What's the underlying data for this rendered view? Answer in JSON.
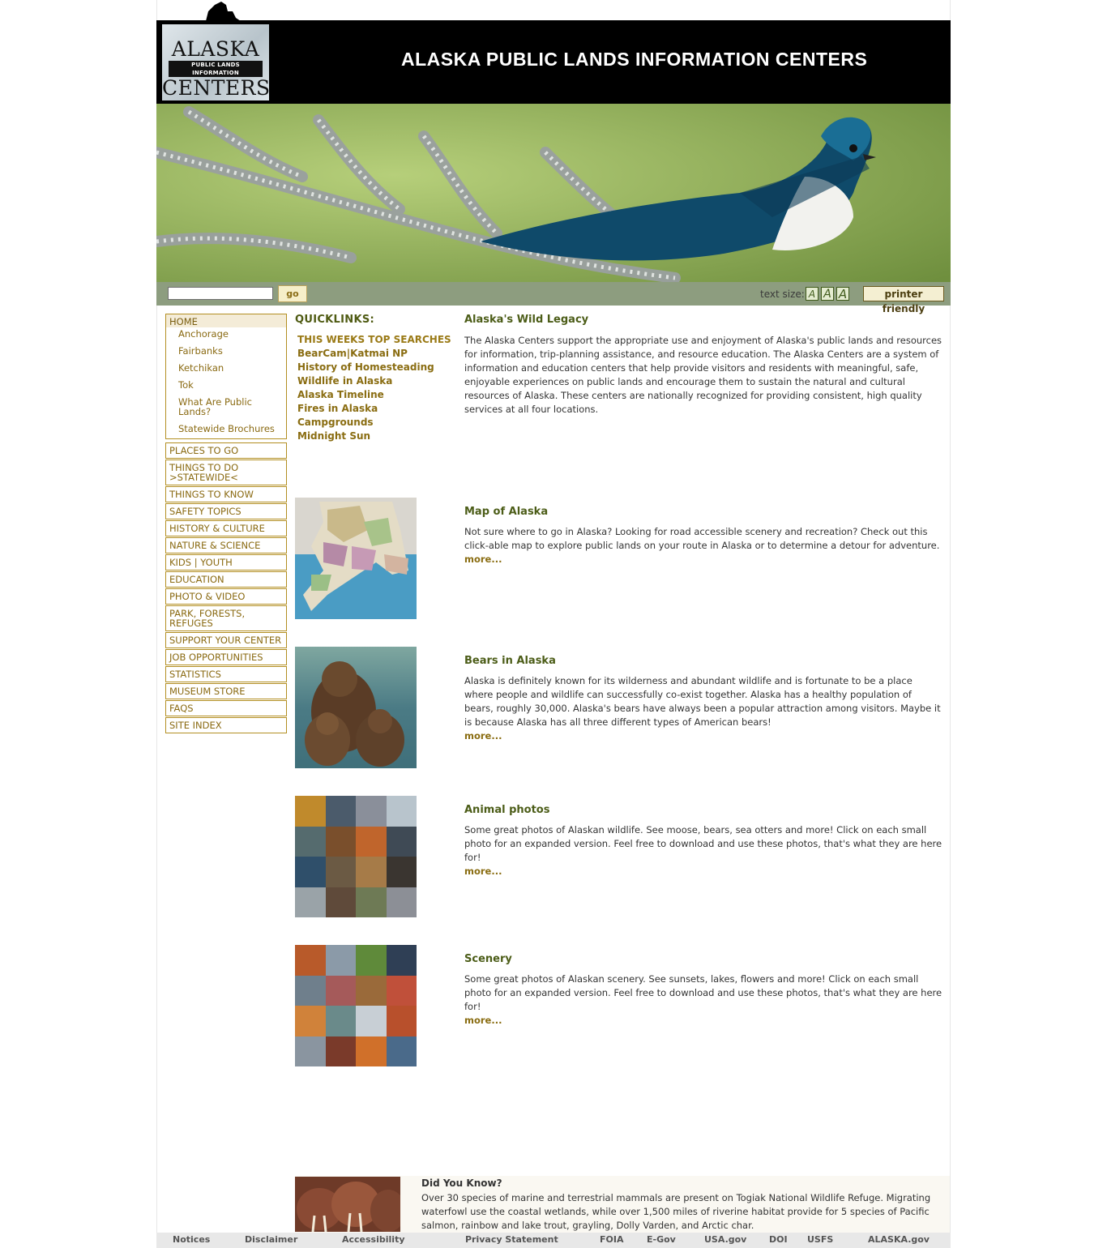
{
  "header": {
    "logo_alaska": "ALASKA",
    "logo_strip": "PUBLIC LANDS INFORMATION",
    "logo_centers": "CENTERS",
    "title": "ALASKA PUBLIC LANDS INFORMATION CENTERS"
  },
  "toolbar": {
    "search_value": "",
    "go_label": "go",
    "text_size_label": "text size:",
    "size_small": "A",
    "size_medium": "A",
    "size_large": "A",
    "printer_label": "printer friendly"
  },
  "sidebar": {
    "home": "HOME",
    "sub_items": [
      "Anchorage",
      "Fairbanks",
      "Ketchikan",
      "Tok",
      "What Are Public Lands?",
      "Statewide Brochures"
    ],
    "items": [
      "PLACES TO GO",
      "THINGS TO DO >STATEWIDE<",
      "THINGS TO KNOW",
      "SAFETY TOPICS",
      "HISTORY & CULTURE",
      "NATURE & SCIENCE",
      "KIDS | YOUTH",
      "EDUCATION",
      "PHOTO & VIDEO",
      "PARK, FORESTS, REFUGES",
      "SUPPORT YOUR CENTER",
      "JOB OPPORTUNITIES",
      "STATISTICS",
      "MUSEUM STORE",
      "FAQS",
      "SITE INDEX"
    ]
  },
  "quicklinks": {
    "title": "QUICKLINKS:",
    "heading": "THIS WEEKS TOP SEARCHES",
    "links": [
      "BearCam|Katmai NP",
      "History of Homesteading",
      "Wildlife in Alaska",
      "Alaska Timeline",
      "Fires in Alaska",
      "Campgrounds",
      "Midnight Sun"
    ]
  },
  "intro": {
    "title": "Alaska's Wild Legacy",
    "text": "The Alaska Centers support the appropriate use and enjoyment of Alaska's public lands and resources for information, trip-planning assistance, and resource education. The Alaska Centers are a system of information and education centers that help provide visitors and residents with meaningful, safe, enjoyable experiences on public lands and encourage them to sustain the natural and cultural resources of Alaska. These centers are nationally recognized for providing consistent, high quality services at all four locations."
  },
  "sections": [
    {
      "title": "Map of Alaska",
      "text": "Not sure where to go in Alaska? Looking for road accessible scenery and recreation? Check out this click-able map to explore public lands on your route in Alaska or to determine a detour for adventure.",
      "more": "more..."
    },
    {
      "title": "Bears in Alaska",
      "text": "Alaska is definitely known for its wilderness and abundant wildlife and is fortunate to be a place where people and wildlife can successfully co-exist together. Alaska has a healthy population of bears, roughly 30,000. Alaska's bears have always been a popular attraction among visitors. Maybe it is because Alaska has all three different types of American bears!",
      "more": "more..."
    },
    {
      "title": "Animal photos",
      "text": "Some great photos of Alaskan wildlife. See moose, bears, sea otters and more! Click on each small photo for an expanded version. Feel free to download and use these photos, that's what they are here for!",
      "more": "more..."
    },
    {
      "title": "Scenery",
      "text": "Some great photos of Alaskan scenery. See sunsets, lakes, flowers and more! Click on each small photo for an expanded version. Feel free to download and use these photos, that's what they are here for!",
      "more": "more..."
    }
  ],
  "did_you_know": {
    "title": "Did You Know?",
    "text": "Over 30 species of marine and terrestrial mammals are present on Togiak National Wildlife Refuge. Migrating waterfowl use the coastal wetlands, while over 1,500 miles of riverine habitat provide for 5 species of Pacific salmon, rainbow and lake trout, grayling, Dolly Varden, and Arctic char."
  },
  "footer": {
    "links": [
      "Notices",
      "Disclaimer",
      "Accessibility",
      "Privacy Statement",
      "FOIA",
      "E-Gov",
      "USA.gov",
      "DOI",
      "USFS",
      "ALASKA.gov"
    ]
  },
  "colors": {
    "link_gold": "#8a6d12",
    "title_green": "#4c5d18",
    "toolbar_gray_green": "#8d9d7f",
    "header_black": "#000000"
  }
}
